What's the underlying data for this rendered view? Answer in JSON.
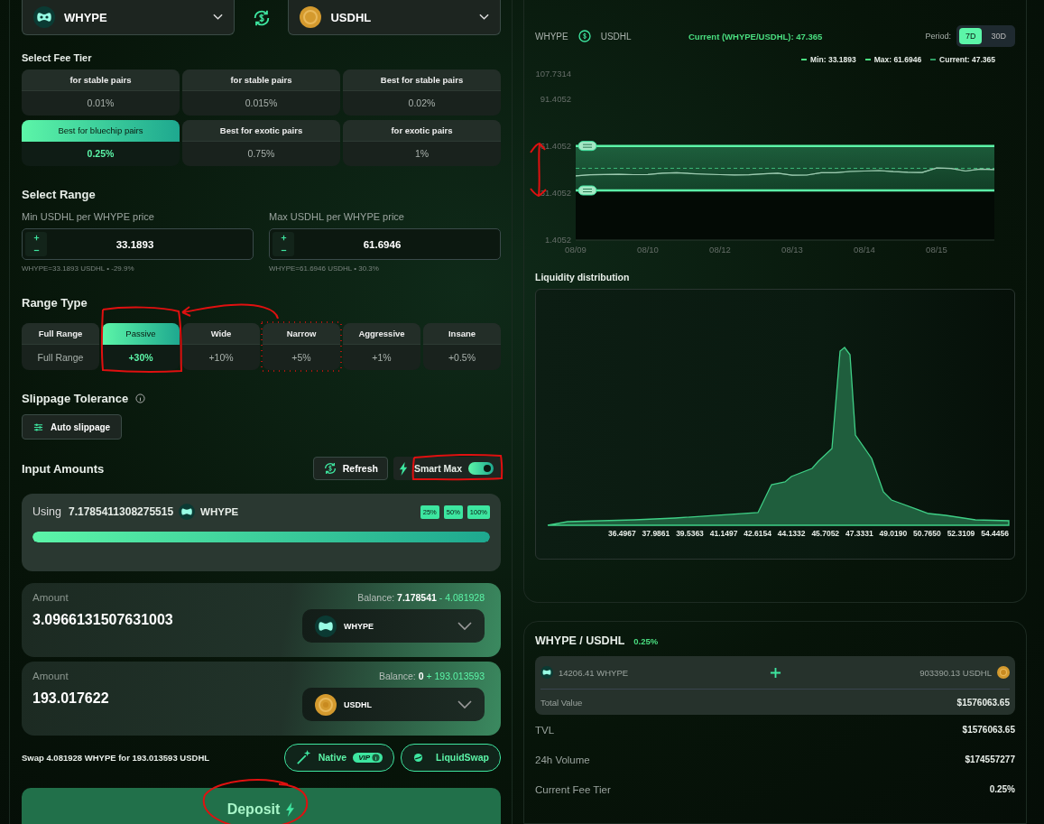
{
  "pair": {
    "base": {
      "symbol": "WHYPE",
      "kind": "hype"
    },
    "quote": {
      "symbol": "USDHL",
      "kind": "coin"
    }
  },
  "fee_tier": {
    "title": "Select Fee Tier",
    "tiers": [
      {
        "label": "for stable pairs",
        "fee": "0.01%",
        "selected": false
      },
      {
        "label": "for stable pairs",
        "fee": "0.015%",
        "selected": false
      },
      {
        "label": "Best for stable pairs",
        "fee": "0.02%",
        "selected": false
      },
      {
        "label": "Best for bluechip pairs",
        "fee": "0.25%",
        "selected": true
      },
      {
        "label": "Best for exotic pairs",
        "fee": "0.75%",
        "selected": false
      },
      {
        "label": "for exotic pairs",
        "fee": "1%",
        "selected": false
      }
    ]
  },
  "range": {
    "title": "Select Range",
    "bounds": [
      {
        "label": "Min USDHL per WHYPE price",
        "value": "33.1893",
        "hint": "WHYPE=33.1893 USDHL • -29.9%"
      },
      {
        "label": "Max USDHL per WHYPE price",
        "value": "61.6946",
        "hint": "WHYPE=61.6946 USDHL • 30.3%"
      }
    ]
  },
  "range_type": {
    "title": "Range Type",
    "options": [
      {
        "label": "Full Range",
        "value": "Full Range",
        "selected": false
      },
      {
        "label": "Passive",
        "value": "+30%",
        "selected": true
      },
      {
        "label": "Wide",
        "value": "+10%",
        "selected": false
      },
      {
        "label": "Narrow",
        "value": "+5%",
        "selected": false
      },
      {
        "label": "Aggressive",
        "value": "+1%",
        "selected": false
      },
      {
        "label": "Insane",
        "value": "+0.5%",
        "selected": false
      }
    ]
  },
  "slippage": {
    "title": "Slippage Tolerance",
    "button": "Auto slippage"
  },
  "input_amounts": {
    "title": "Input Amounts",
    "refresh": "Refresh",
    "smart_max": {
      "label": "Smart Max",
      "on": true
    },
    "using": {
      "label": "Using",
      "amount": "7.1785411308275515",
      "token": "WHYPE",
      "kind": "hype",
      "level": 1
    },
    "percent_buttons": [
      "25%",
      "50%",
      "100%"
    ]
  },
  "amounts": [
    {
      "label": "Amount",
      "balance_label": "Balance:",
      "balance": "7.178541",
      "delta": "- 4.081928",
      "value": "3.0966131507631003",
      "token": "WHYPE",
      "kind": "hype"
    },
    {
      "label": "Amount",
      "balance_label": "Balance:",
      "balance": "0",
      "delta": "+ 193.013593",
      "value": "193.017622",
      "token": "USDHL",
      "kind": "coin"
    }
  ],
  "swap": {
    "text": "Swap 4.081928 WHYPE for 193.013593 USDHL",
    "routes": [
      {
        "label": "Native",
        "badge": "VIP",
        "kind": "wand"
      },
      {
        "label": "LiquidSwap",
        "kind": "liquid"
      }
    ]
  },
  "deposit": "Deposit",
  "price_chart": {
    "base": "WHYPE",
    "quote": "USDHL",
    "current": "Current (WHYPE/USDHL): 47.365",
    "period_label": "Period:",
    "periods": [
      {
        "label": "7D",
        "selected": true
      },
      {
        "label": "30D",
        "selected": false
      }
    ],
    "legend": [
      {
        "label": "Min: 33.1893",
        "color": "#4ade80"
      },
      {
        "label": "Max: 61.6946",
        "color": "#4ade80"
      },
      {
        "label": "Current: 47.365",
        "color": "#2f9e63"
      }
    ],
    "chart_data": {
      "type": "line",
      "ylim": [
        1.4052,
        107.7314
      ],
      "categories": [
        "08/09",
        null,
        null,
        null,
        null,
        "08/10",
        null,
        null,
        null,
        null,
        "08/12",
        null,
        null,
        null,
        null,
        "08/13",
        null,
        null,
        null,
        null,
        "08/14",
        null,
        null,
        null,
        null,
        "08/15",
        null,
        null,
        null,
        null
      ],
      "yticks": [
        1.4052,
        31.4052,
        61.4052,
        91.4052,
        107.7314
      ],
      "series": [
        {
          "color": "#9ec9b0",
          "values": [
            42.5,
            43.2,
            43.4,
            43.5,
            43.3,
            43.4,
            44.2,
            44.6,
            44.0,
            43.6,
            43.3,
            43.1,
            43.2,
            43.8,
            44.3,
            42.9,
            43.0,
            44.5,
            44.6,
            45.3,
            45.6,
            45.9,
            45.2,
            44.8,
            44.7,
            47.5,
            47.3,
            45.6,
            46.8,
            46.6
          ]
        }
      ]
    }
  },
  "liquidity": {
    "title": "Liquidity distribution",
    "axis_labels": [
      "36.4967",
      "37.9861",
      "39.5363",
      "41.1497",
      "42.6154",
      "44.1332",
      "45.7052",
      "47.3331",
      "49.0190",
      "50.7650",
      "52.3109",
      "54.4456"
    ]
  },
  "pool": {
    "title": "WHYPE / USDHL",
    "fee": "0.25%",
    "base_amount": "14206.41 WHYPE",
    "quote_amount": "903390.13 USDHL",
    "total_label": "Total Value",
    "total": "$1576063.65",
    "stats": [
      {
        "label": "TVL",
        "value": "$1576063.65"
      },
      {
        "label": "24h Volume",
        "value": "$174557277"
      },
      {
        "label": "Current Fee Tier",
        "value": "0.25%"
      }
    ]
  }
}
